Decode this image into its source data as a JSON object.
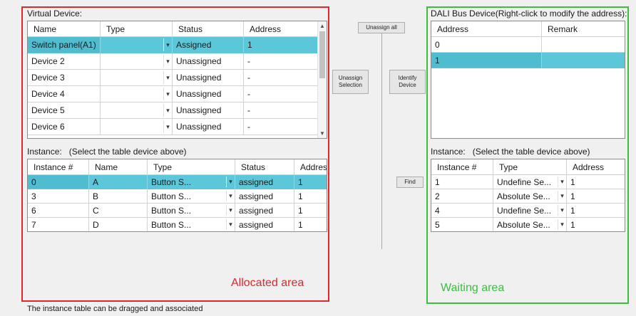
{
  "left_panel": {
    "virtual_device_label": "Virtual Device:",
    "virtual_table": {
      "columns": [
        "Name",
        "Type",
        "Status",
        "Address"
      ],
      "rows": [
        {
          "name": "Switch panel(A1)",
          "type": "",
          "status": "Assigned",
          "address": "1",
          "selected": true
        },
        {
          "name": "Device 2",
          "type": "",
          "status": "Unassigned",
          "address": "-",
          "selected": false
        },
        {
          "name": "Device 3",
          "type": "",
          "status": "Unassigned",
          "address": "-",
          "selected": false
        },
        {
          "name": "Device 4",
          "type": "",
          "status": "Unassigned",
          "address": "-",
          "selected": false
        },
        {
          "name": "Device 5",
          "type": "",
          "status": "Unassigned",
          "address": "-",
          "selected": false
        },
        {
          "name": "Device 6",
          "type": "",
          "status": "Unassigned",
          "address": "-",
          "selected": false
        }
      ]
    },
    "instance_label": "Instance:",
    "instance_hint": "(Select the table device above)",
    "instance_table": {
      "columns": [
        "Instance #",
        "Name",
        "Type",
        "Status",
        "Address"
      ],
      "rows": [
        {
          "instance": "0",
          "name": "A",
          "type": "Button S...",
          "status": "assigned",
          "address": "1",
          "selected": true
        },
        {
          "instance": "3",
          "name": "B",
          "type": "Button S...",
          "status": "assigned",
          "address": "1",
          "selected": false
        },
        {
          "instance": "6",
          "name": "C",
          "type": "Button S...",
          "status": "assigned",
          "address": "1",
          "selected": false
        },
        {
          "instance": "7",
          "name": "D",
          "type": "Button S...",
          "status": "assigned",
          "address": "1",
          "selected": false
        }
      ]
    },
    "area_label": "Allocated area"
  },
  "middle": {
    "unassign_all": "Unassign all",
    "unassign_selection": "Unassign Selection",
    "identify_device": "Identify Device",
    "find": "Find"
  },
  "right_panel": {
    "bus_label": "DALI Bus Device(Right-click to modify the address):",
    "bus_table": {
      "columns": [
        "Address",
        "Remark"
      ],
      "rows": [
        {
          "address": "0",
          "remark": "",
          "selected": false
        },
        {
          "address": "1",
          "remark": "",
          "selected": true
        }
      ]
    },
    "instance_label": "Instance:",
    "instance_hint": "(Select the table device above)",
    "instance_table": {
      "columns": [
        "Instance #",
        "Type",
        "Address"
      ],
      "rows": [
        {
          "instance": "1",
          "type": "Undefine Se...",
          "address": "1"
        },
        {
          "instance": "2",
          "type": "Absolute Se...",
          "address": "1"
        },
        {
          "instance": "4",
          "type": "Undefine Se...",
          "address": "1"
        },
        {
          "instance": "5",
          "type": "Absolute Se...",
          "address": "1"
        }
      ]
    },
    "area_label": "Waiting area"
  },
  "footer_note": "The instance table can be dragged and associated",
  "colors": {
    "selection": "#5cc7d8",
    "allocated_frame": "#e2262b",
    "waiting_frame": "#3bbf3f",
    "background": "#f0f0f0"
  }
}
